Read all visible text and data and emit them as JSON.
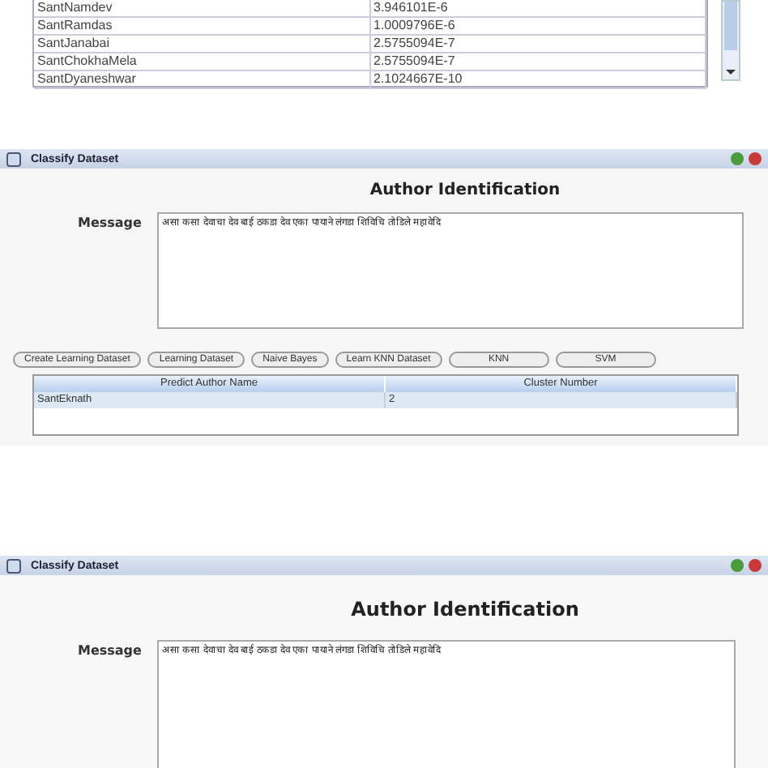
{
  "results_table": {
    "rows": [
      {
        "author": "SantNamdev",
        "value": "3.946101E-6"
      },
      {
        "author": "SantRamdas",
        "value": "1.0009796E-6"
      },
      {
        "author": "SantJanabai",
        "value": "2.5755094E-7"
      },
      {
        "author": "SantChokhaMela",
        "value": "2.5755094E-7"
      },
      {
        "author": "SantDyaneshwar",
        "value": "2.1024667E-10"
      }
    ]
  },
  "windows": [
    {
      "title": "Classify Dataset",
      "heading": "Author Identification",
      "message_label": "Message",
      "message": "असा कसा देवाचा देव बाई ठकडा देव एका पायाने लंगडा शिविचि तोडिले महावेदि",
      "buttons": [
        "Create Learning Dataset",
        "Learning Dataset",
        "Naive Bayes",
        "Learn KNN Dataset",
        "KNN",
        "SVM"
      ],
      "prediction_table": {
        "columns": [
          "Predict Author Name",
          "Cluster Number"
        ],
        "rows": [
          {
            "cells": [
              "SantEknath",
              "2"
            ],
            "selected": true
          }
        ]
      }
    },
    {
      "title": "Classify Dataset",
      "heading": "Author Identification",
      "message_label": "Message",
      "message": "असा कसा देवाचा देव बाई ठकडा देव एका पायाने लंगडा शिविचि तोडिले महावेदि"
    }
  ]
}
